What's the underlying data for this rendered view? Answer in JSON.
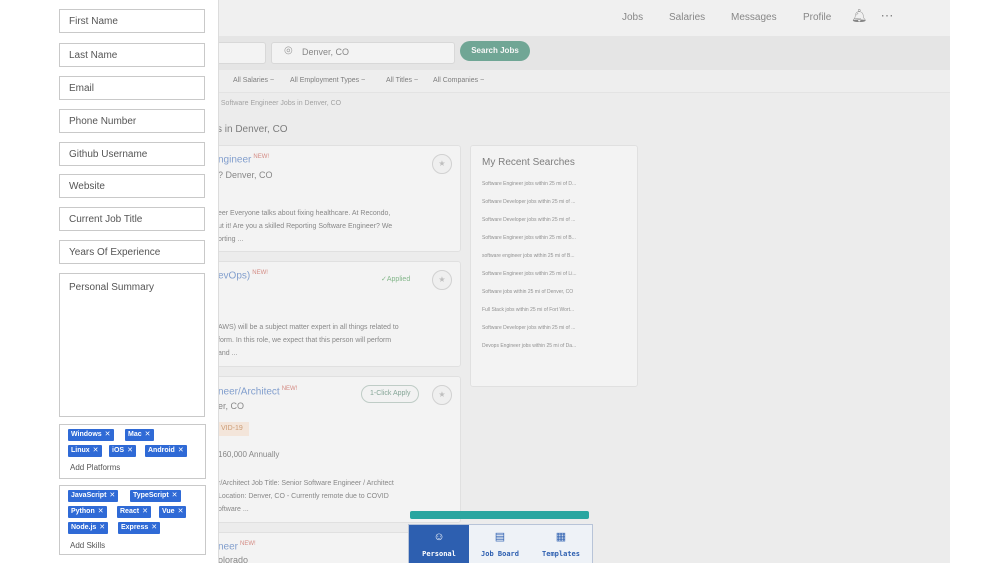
{
  "nav": {
    "links": [
      "Jobs",
      "Salaries",
      "Messages",
      "Profile"
    ]
  },
  "search": {
    "location": "Denver, CO",
    "button": "Search Jobs"
  },
  "filters": [
    "All Salaries ~",
    "All Employment Types ~",
    "All Titles ~",
    "All Companies ~"
  ],
  "breadcrumb": "/  Software Engineer Jobs in Denver, CO",
  "results_title": "s in Denver, CO",
  "jobs": [
    {
      "title": "ngineer",
      "badge": "NEW!",
      "location": "Denver, CO",
      "location_prefix": "?",
      "text_lines": [
        "eer Everyone talks about fixing healthcare. At Recondo,",
        "ut it! Are you a skilled Reporting Software Engineer? We",
        "orting ..."
      ]
    },
    {
      "title": "evOps)",
      "badge": "NEW!",
      "status": "✓Applied",
      "text_lines": [
        "AWS) will be a subject matter expert in all things related to",
        "form. In this role, we expect that this person will perform",
        "and ..."
      ]
    },
    {
      "title": "neer/Architect",
      "badge": "NEW!",
      "location": "er, CO",
      "apply": "1-Click Apply",
      "tag": "VID-19",
      "salary": "160,000 Annually",
      "text_lines": [
        "r/Architect Job Title: Senior Software Engineer / Architect",
        "Location: Denver, CO - Currently remote due to COVID",
        "oftware ..."
      ]
    },
    {
      "title": "neer",
      "badge": "NEW!",
      "location": "olorado"
    }
  ],
  "recent": {
    "title": "My Recent Searches",
    "items": [
      "Software Engineer jobs within 25 mi of D...",
      "Software Developer jobs within 25 mi of ...",
      "Software Developer jobs within 25 mi of ...",
      "Software Engineer jobs within 25 mi of B...",
      "software engineer jobs within 25 mi of B...",
      "Software Engineer jobs within 25 mi of Li...",
      "Software jobs within 25 mi of Denver, CO",
      "Full Stack jobs within 25 mi of Fort Wort...",
      "Software Developer jobs within 25 mi of ...",
      "Devops Engineer jobs within 25 mi of Da..."
    ]
  },
  "form": {
    "first_name": "First Name",
    "last_name": "Last Name",
    "email": "Email",
    "phone": "Phone Number",
    "github": "Github Username",
    "website": "Website",
    "job_title": "Current Job Title",
    "experience": "Years Of Experience",
    "summary": "Personal Summary",
    "platforms": [
      "Windows",
      "Mac",
      "Linux",
      "iOS",
      "Android"
    ],
    "platforms_add": "Add Platforms",
    "skills": [
      "JavaScript",
      "TypeScript",
      "Python",
      "React",
      "Vue",
      "Node.js",
      "Express"
    ],
    "skills_add": "Add Skills"
  },
  "extension": {
    "tabs": [
      "Personal",
      "Job Board",
      "Templates"
    ],
    "active_tab": "Personal"
  },
  "colors": {
    "chip": "#2f6ad6",
    "tab_active": "#2d5fb0",
    "progress": "#2aa6a0",
    "search_button": "#0b6e4f"
  }
}
